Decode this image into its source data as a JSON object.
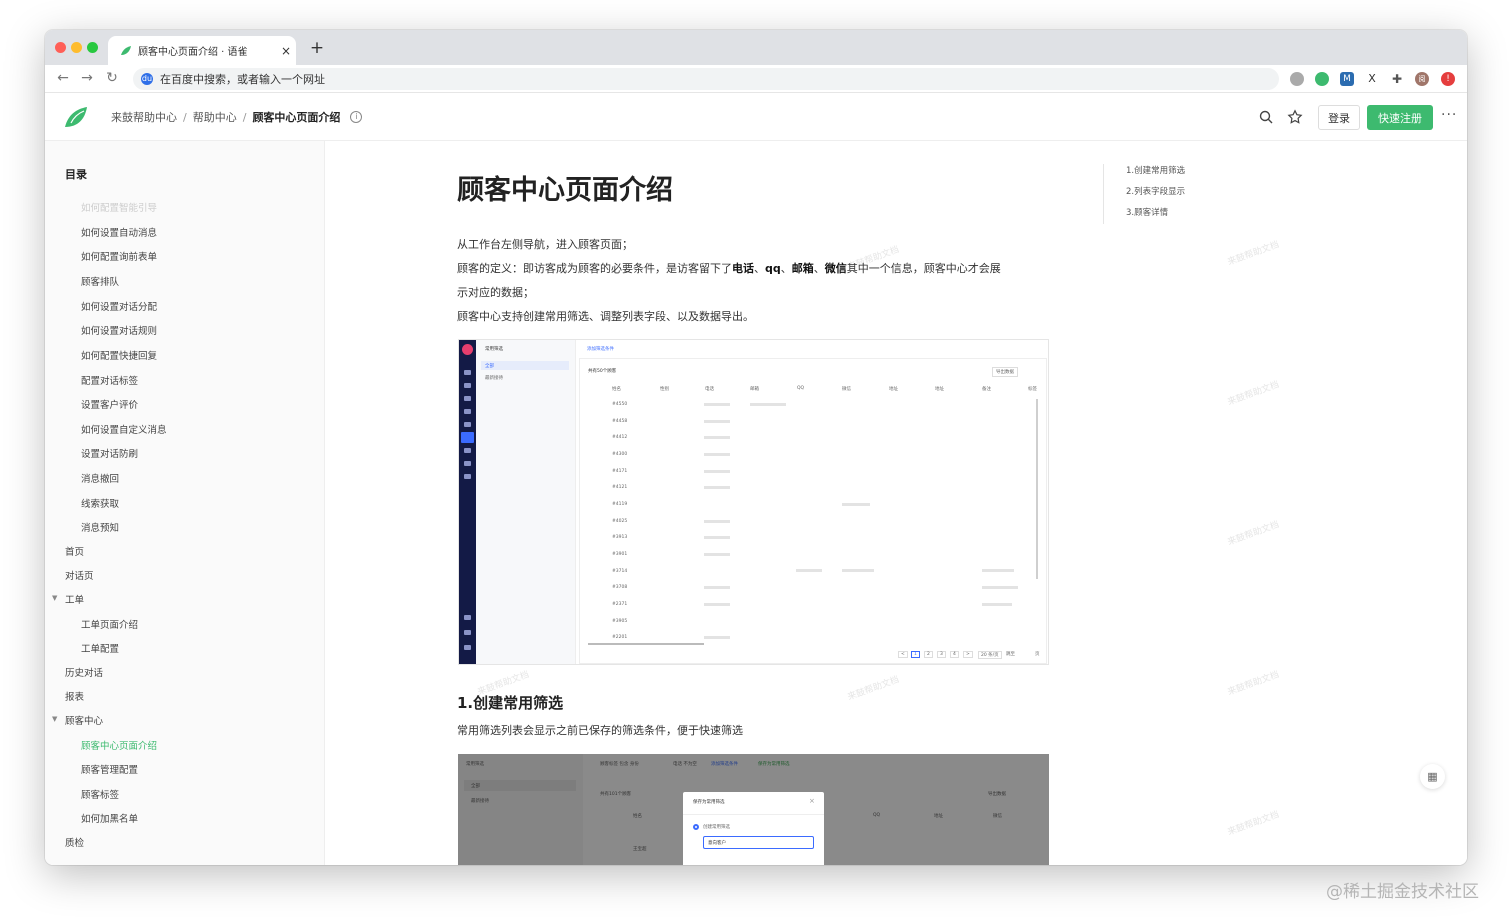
{
  "browser": {
    "tab_title": "顾客中心页面介绍 · 语雀",
    "tab_close": "×",
    "new_tab": "+",
    "address_placeholder": "在百度中搜索，或者输入一个网址",
    "address_badge": "du",
    "extensions": [
      "ext-1",
      "ext-2",
      "ext-3",
      "ext-4",
      "ext-5",
      "profile",
      "ext-6"
    ],
    "ext_labels": {
      "m": "M",
      "x": "X",
      "profile": "阅",
      "alert": "!"
    }
  },
  "header": {
    "breadcrumb": [
      "来鼓帮助中心",
      "帮助中心",
      "顾客中心页面介绍"
    ],
    "breadcrumb_sep": "/",
    "info_icon": "i",
    "login": "登录",
    "register": "快速注册",
    "more": "···"
  },
  "sidebar": {
    "title": "目录",
    "items": [
      {
        "label": "如何配置智能引导",
        "level": 2,
        "state": "faded"
      },
      {
        "label": "如何设置自动消息",
        "level": 2
      },
      {
        "label": "如何配置询前表单",
        "level": 2
      },
      {
        "label": "顾客排队",
        "level": 2
      },
      {
        "label": "如何设置对话分配",
        "level": 2
      },
      {
        "label": "如何设置对话规则",
        "level": 2
      },
      {
        "label": "如何配置快捷回复",
        "level": 2
      },
      {
        "label": "配置对话标签",
        "level": 2
      },
      {
        "label": "设置客户评价",
        "level": 2
      },
      {
        "label": "如何设置自定义消息",
        "level": 2
      },
      {
        "label": "设置对话防刷",
        "level": 2
      },
      {
        "label": "消息撤回",
        "level": 2
      },
      {
        "label": "线索获取",
        "level": 2
      },
      {
        "label": "消息预知",
        "level": 2
      },
      {
        "label": "首页",
        "level": 1
      },
      {
        "label": "对话页",
        "level": 1
      },
      {
        "label": "工单",
        "level": 1,
        "expanded": true
      },
      {
        "label": "工单页面介绍",
        "level": 2
      },
      {
        "label": "工单配置",
        "level": 2
      },
      {
        "label": "历史对话",
        "level": 1
      },
      {
        "label": "报表",
        "level": 1
      },
      {
        "label": "顾客中心",
        "level": 1,
        "expanded": true
      },
      {
        "label": "顾客中心页面介绍",
        "level": 2,
        "state": "active"
      },
      {
        "label": "顾客管理配置",
        "level": 2
      },
      {
        "label": "顾客标签",
        "level": 2
      },
      {
        "label": "如何加黑名单",
        "level": 2
      },
      {
        "label": "质检",
        "level": 1
      }
    ]
  },
  "article": {
    "title": "顾客中心页面介绍",
    "p1": "从工作台左侧导航，进入顾客页面；",
    "p2_prefix": "顾客的定义：即访客成为顾客的必要条件，是访客留下了",
    "p2_b1": "电话",
    "p2_sep1": "、",
    "p2_b2": "qq",
    "p2_sep2": "、",
    "p2_b3": "邮箱",
    "p2_sep3": "、",
    "p2_b4": "微信",
    "p2_suffix": "其中一个信息，顾客中心才会展",
    "p2_cont": "示对应的数据；",
    "p3": "顾客中心支持创建常用筛选、调整列表字段、以及数据导出。",
    "h2": "1.创建常用筛选",
    "p4": "常用筛选列表会显示之前已保存的筛选条件，便于快速筛选",
    "watermark": "来鼓帮助文档"
  },
  "screenshot1": {
    "panel_title": "常用筛选",
    "panel_items": [
      "全部",
      "最新接待"
    ],
    "add_filter": "添加筛选条件",
    "count": "共有50个顾客",
    "export": "导出数据",
    "columns": [
      "姓名",
      "性别",
      "电话",
      "邮箱",
      "QQ",
      "微信",
      "地址",
      "地址",
      "备注",
      "标签"
    ],
    "rows": [
      "#4550",
      "#4458",
      "#4412",
      "#4300",
      "#4171",
      "#4121",
      "#4119",
      "#4025",
      "#3913",
      "#3901",
      "#3714",
      "#3708",
      "#2371",
      "#3905",
      "#2201"
    ],
    "pagination": [
      "<",
      "1",
      "2",
      "3",
      "4",
      ">",
      "20 条/页",
      "跳至",
      "页"
    ]
  },
  "screenshot2": {
    "panel_title": "常用筛选",
    "panel_items": [
      "全部",
      "最新接待"
    ],
    "toolbar": "顾客标签 包含 身份",
    "phone_filter": "电话 不为空",
    "add_filter": "添加筛选条件",
    "save_filter": "保存为常用筛选",
    "count": "共有101个顾客",
    "export": "导出数据",
    "cols": [
      "姓名",
      "QQ",
      "地址",
      "微信"
    ],
    "cell": "王宝超",
    "modal_title": "保存为常用筛选",
    "modal_close": "×",
    "modal_option": "创建常用筛选",
    "modal_input": "意向客户"
  },
  "outline": [
    "1.创建常用筛选",
    "2.列表字段显示",
    "3.顾客详情"
  ],
  "qr_icon": "qr-code",
  "qr_glyph": "▦",
  "page_watermark": "@稀土掘金技术社区",
  "colors": {
    "accent": "#3dba6f",
    "rail": "#131a46"
  }
}
